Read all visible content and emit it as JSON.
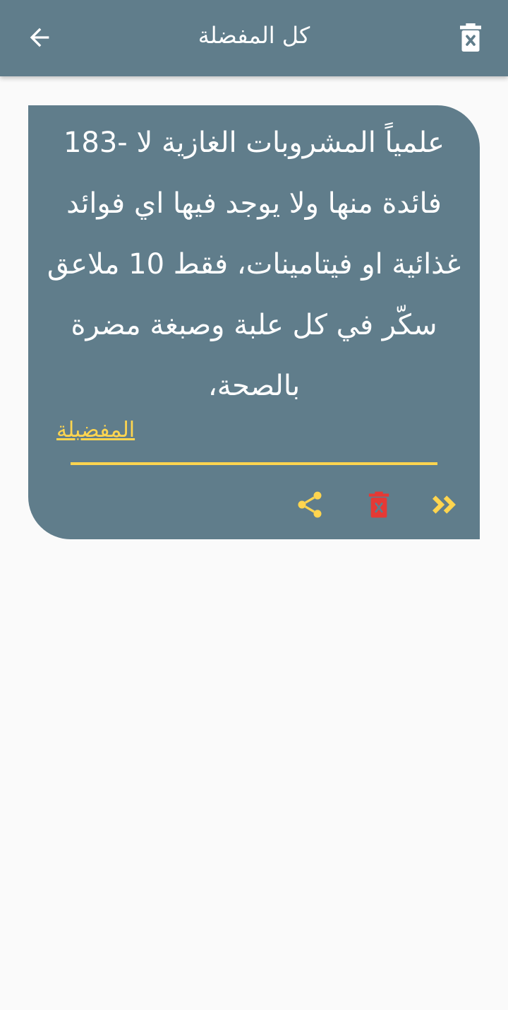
{
  "appbar": {
    "title": "كل المفضلة",
    "back_icon": "arrow-back-icon",
    "clear_icon": "delete-forever-icon",
    "background_color": "#607d8b"
  },
  "card": {
    "quote": "علمياً المشروبات الغازية لا -183 فائدة منها ولا يوجد فيها اي فوائد غذائية او فيتامينات، فقط 10 ملاعق سكّر في كل علبة وصبغة مضرة بالصحة،",
    "category_label": "المفضبلة",
    "actions": {
      "share_icon": "share-icon",
      "delete_icon": "delete-forever-icon",
      "next_icon": "double-chevron-icon"
    },
    "colors": {
      "background": "#607d8b",
      "accent": "#ffd54f",
      "delete": "#e53935"
    }
  }
}
